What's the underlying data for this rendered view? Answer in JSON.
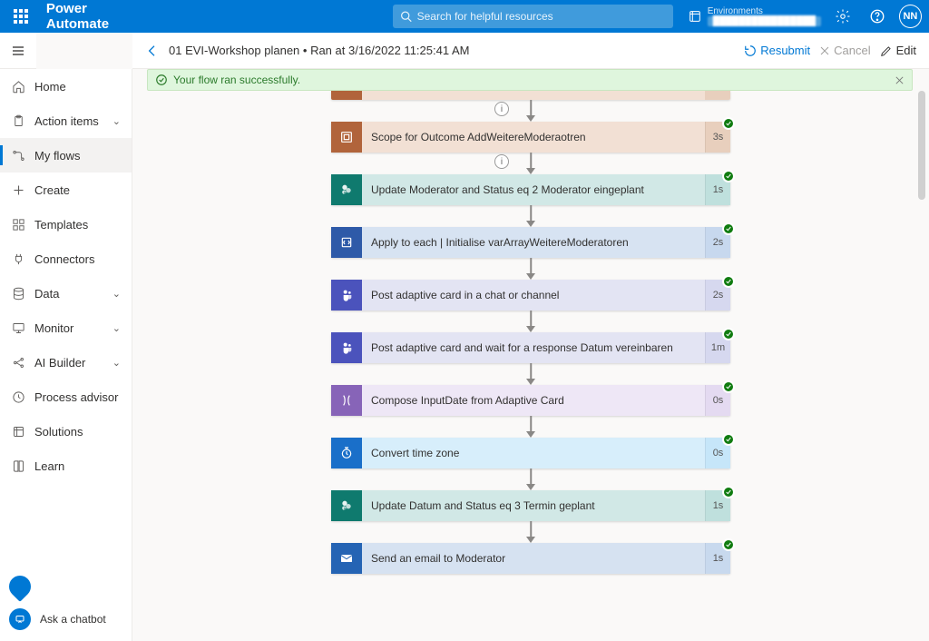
{
  "suite": {
    "app_title": "Power Automate",
    "search_placeholder": "Search for helpful resources",
    "env_label": "Environments",
    "env_name": "████████████████",
    "avatar_initials": "NN"
  },
  "page_header": {
    "title": "01 EVI-Workshop planen • Ran at 3/16/2022 11:25:41 AM",
    "resubmit": "Resubmit",
    "cancel": "Cancel",
    "edit": "Edit"
  },
  "banner": {
    "text": "Your flow ran successfully."
  },
  "nav": {
    "items": [
      {
        "label": "Home",
        "icon": "home"
      },
      {
        "label": "Action items",
        "icon": "clipboard",
        "chevron": true
      },
      {
        "label": "My flows",
        "icon": "flow",
        "active": true
      },
      {
        "label": "Create",
        "icon": "plus"
      },
      {
        "label": "Templates",
        "icon": "template"
      },
      {
        "label": "Connectors",
        "icon": "connector"
      },
      {
        "label": "Data",
        "icon": "data",
        "chevron": true
      },
      {
        "label": "Monitor",
        "icon": "monitor",
        "chevron": true
      },
      {
        "label": "AI Builder",
        "icon": "ai",
        "chevron": true
      },
      {
        "label": "Process advisor",
        "icon": "process"
      },
      {
        "label": "Solutions",
        "icon": "solutions"
      },
      {
        "label": "Learn",
        "icon": "learn"
      }
    ],
    "chatbot": "Ask a chatbot"
  },
  "cards": [
    {
      "theme": "c-scope",
      "icon": "scope",
      "label": "Scope for Outcome AddWeitereModeraotren",
      "time": "3s"
    },
    {
      "theme": "c-sp",
      "icon": "sharepoint",
      "label": "Update Moderator and Status eq 2 Moderator eingeplant",
      "time": "1s"
    },
    {
      "theme": "c-apply",
      "icon": "loop",
      "label": "Apply to each | Initialise varArrayWeitereModeratoren",
      "time": "2s"
    },
    {
      "theme": "c-teams",
      "icon": "teams",
      "label": "Post adaptive card in a chat or channel",
      "time": "2s"
    },
    {
      "theme": "c-teams",
      "icon": "teams",
      "label": "Post adaptive card and wait for a response Datum vereinbaren",
      "time": "1m"
    },
    {
      "theme": "c-compose",
      "icon": "compose",
      "label": "Compose InputDate from Adaptive Card",
      "time": "0s"
    },
    {
      "theme": "c-time",
      "icon": "clock",
      "label": "Convert time zone",
      "time": "0s"
    },
    {
      "theme": "c-sp",
      "icon": "sharepoint",
      "label": "Update Datum and Status eq 3 Termin geplant",
      "time": "1s"
    },
    {
      "theme": "c-mail",
      "icon": "mail",
      "label": "Send an email to Moderator",
      "time": "1s"
    }
  ]
}
